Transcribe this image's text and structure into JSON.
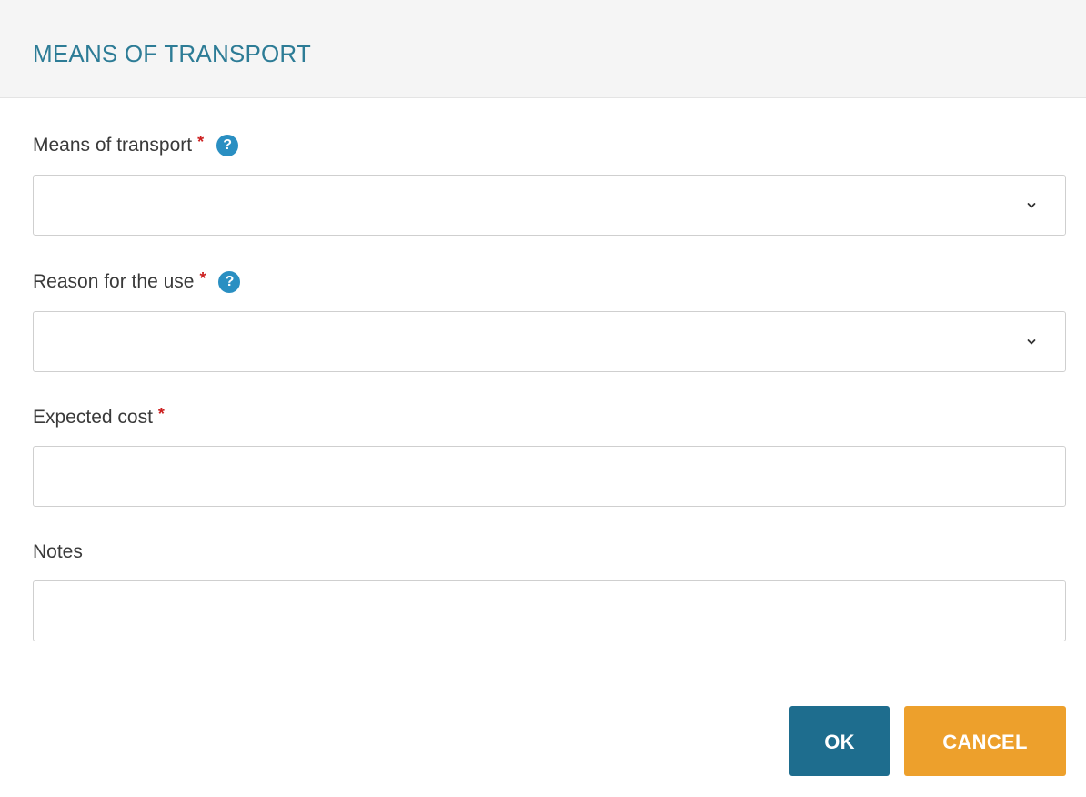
{
  "dialog": {
    "title": "MEANS OF TRANSPORT"
  },
  "fields": {
    "means_of_transport": {
      "label": "Means of transport",
      "required_mark": "*",
      "help_glyph": "?",
      "value": "",
      "help_icon": "question-circle-icon",
      "chevron_icon": "chevron-down-icon"
    },
    "reason_for_use": {
      "label": "Reason for the use",
      "required_mark": "*",
      "help_glyph": "?",
      "value": "",
      "help_icon": "question-circle-icon",
      "chevron_icon": "chevron-down-icon"
    },
    "expected_cost": {
      "label": "Expected cost",
      "required_mark": "*",
      "value": ""
    },
    "notes": {
      "label": "Notes",
      "value": ""
    }
  },
  "buttons": {
    "ok_label": "OK",
    "cancel_label": "CANCEL"
  },
  "colors": {
    "title": "#2d7c96",
    "required": "#cc1f1f",
    "help_icon": "#2a8fc2",
    "ok_button": "#1e6d8e",
    "cancel_button": "#eda02c",
    "header_background": "#f5f5f5"
  }
}
